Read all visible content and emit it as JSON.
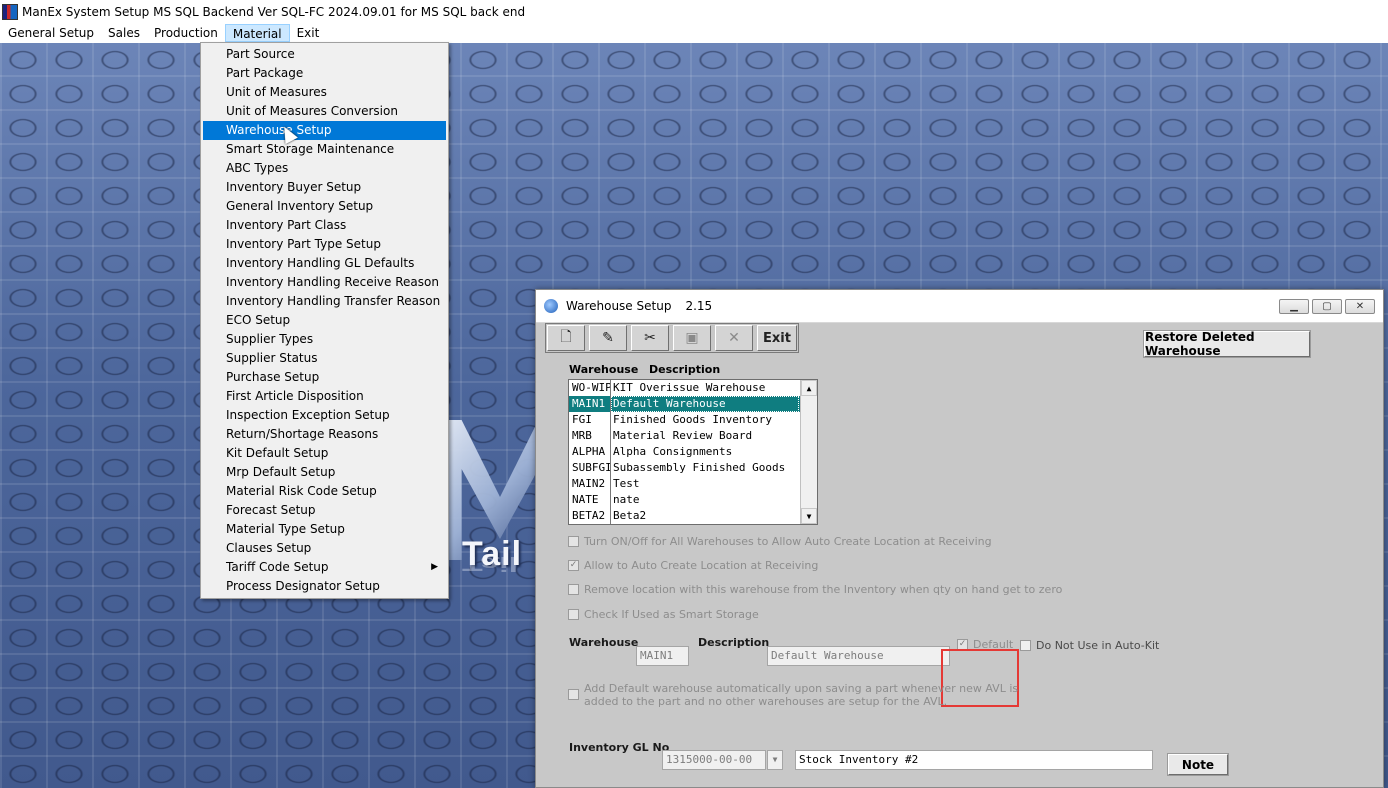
{
  "app": {
    "title": "ManEx System Setup MS SQL Backend Ver SQL-FC 2024.09.01 for MS SQL back end"
  },
  "menubar": [
    "General Setup",
    "Sales",
    "Production",
    "Material",
    "Exit"
  ],
  "material_menu": {
    "items": [
      "Part Source",
      "Part Package",
      "Unit of Measures",
      "Unit of Measures Conversion",
      "Warehouse Setup",
      "Smart Storage Maintenance",
      "ABC Types",
      "Inventory Buyer Setup",
      "General Inventory Setup",
      "Inventory Part Class",
      "Inventory Part Type Setup",
      "Inventory Handling GL Defaults",
      "Inventory Handling Receive Reason",
      "Inventory Handling Transfer Reason",
      "ECO Setup",
      "Supplier Types",
      "Supplier Status",
      "Purchase Setup",
      "First Article Disposition",
      "Inspection Exception Setup",
      "Return/Shortage Reasons",
      "Kit Default Setup",
      "Mrp Default Setup",
      "Material Risk Code Setup",
      "Forecast Setup",
      "Material Type Setup",
      "Clauses Setup",
      "Tariff Code Setup",
      "Process Designator Setup"
    ],
    "selected": "Warehouse Setup",
    "submenu_item": "Tariff Code Setup"
  },
  "logo": {
    "text": "Tail"
  },
  "window": {
    "title": "Warehouse Setup",
    "version": "2.15",
    "toolbar": {
      "exit_label": "Exit"
    },
    "restore_button": "Restore Deleted Warehouse",
    "grid": {
      "headers": [
        "Warehouse",
        "Description"
      ],
      "rows": [
        [
          "WO-WIP",
          "KIT Overissue Warehouse"
        ],
        [
          "MAIN1",
          "Default Warehouse"
        ],
        [
          "FGI",
          "Finished Goods Inventory"
        ],
        [
          "MRB",
          "Material Review Board"
        ],
        [
          "ALPHA",
          "Alpha Consignments"
        ],
        [
          "SUBFGI",
          "Subassembly Finished Goods"
        ],
        [
          "MAIN2",
          "Test"
        ],
        [
          "NATE",
          "nate"
        ],
        [
          "BETA2",
          "Beta2"
        ]
      ],
      "selected_index": 1
    },
    "options": {
      "auto_create_all": "Turn ON/Off for All Warehouses to Allow Auto Create Location at Receiving",
      "allow_auto_create": "Allow to Auto Create Location at Receiving",
      "remove_location": "Remove location with this warehouse from the Inventory when qty on hand get to zero",
      "smart_storage": "Check If Used as Smart Storage",
      "add_default_line1": "Add Default warehouse automatically upon saving a part whenever new AVL is",
      "add_default_line2": "added to the part and no other warehouses are setup for the AVL."
    },
    "fields": {
      "warehouse_label": "Warehouse",
      "warehouse_value": "MAIN1",
      "description_label": "Description",
      "description_value": "Default Warehouse",
      "default_label": "Default",
      "do_not_use_label": "Do Not Use in Auto-Kit",
      "gl_label": "Inventory GL No",
      "gl_value": "1315000-00-00",
      "gl_description": "Stock Inventory #2",
      "note_button": "Note"
    },
    "checks": {
      "auto_create_all": false,
      "allow_auto_create": true,
      "remove_location": false,
      "smart_storage": false,
      "default": true,
      "do_not_use": false,
      "add_default": false
    }
  }
}
